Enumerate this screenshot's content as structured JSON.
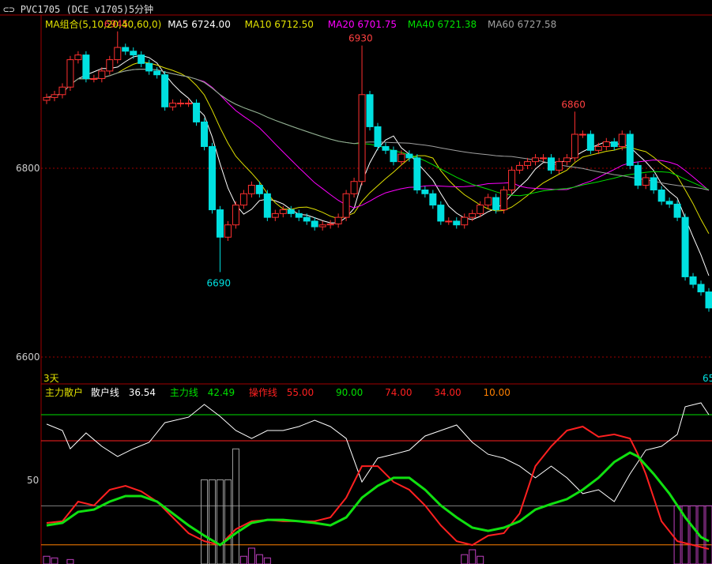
{
  "window": {
    "title": "PVC1705 (DCE v1705)5分钟",
    "icon": "link-icon"
  },
  "legend": {
    "group": "MA组合(5,10,20,40,60,0)",
    "items": [
      {
        "label": "MA5 6724.00",
        "color": "#ffffff"
      },
      {
        "label": "MA10 6712.50",
        "color": "#e0e000"
      },
      {
        "label": "MA20 6701.75",
        "color": "#ff00ff"
      },
      {
        "label": "MA40 6721.38",
        "color": "#00e000"
      },
      {
        "label": "MA60 6727.58",
        "color": "#a0a0a0"
      }
    ]
  },
  "price_axis": {
    "ticks": [
      "6800",
      "6600"
    ]
  },
  "bottom_label": "3天",
  "right_cut_label": "65",
  "indicator": {
    "name": "主力散户",
    "items": [
      {
        "label": "散户线",
        "value": "36.54",
        "color": "#ffffff"
      },
      {
        "label": "主力线",
        "value": "42.49",
        "color": "#00e000"
      },
      {
        "label": "操作线",
        "value": "55.00",
        "color": "#ff2020"
      }
    ],
    "levels": [
      {
        "value": "90.00",
        "color": "#00e000"
      },
      {
        "value": "74.00",
        "color": "#ff2020"
      },
      {
        "value": "34.00",
        "color": "#ff2020"
      },
      {
        "value": "10.00",
        "color": "#ff8000"
      }
    ],
    "axis_tick": "50"
  },
  "chart_data": [
    {
      "type": "candlestick",
      "title": "PVC1705 5分钟",
      "ylim": [
        6600,
        6950
      ],
      "close": [
        6875,
        6878,
        6886,
        6915,
        6920,
        6895,
        6895,
        6903,
        6915,
        6928,
        6924,
        6920,
        6911,
        6903,
        6899,
        6865,
        6869,
        6869,
        6869,
        6849,
        6823,
        6756,
        6727,
        6740,
        6761,
        6773,
        6782,
        6773,
        6748,
        6752,
        6756,
        6752,
        6748,
        6744,
        6738,
        6740,
        6741,
        6748,
        6773,
        6786,
        6878,
        6844,
        6823,
        6819,
        6807,
        6815,
        6811,
        6777,
        6773,
        6761,
        6744,
        6744,
        6740,
        6748,
        6752,
        6761,
        6769,
        6756,
        6777,
        6798,
        6803,
        6807,
        6811,
        6811,
        6798,
        6807,
        6811,
        6836,
        6836,
        6819,
        6823,
        6828,
        6823,
        6836,
        6803,
        6782,
        6790,
        6777,
        6765,
        6762,
        6748,
        6685,
        6677,
        6669,
        6652
      ],
      "annotations": [
        {
          "index": 9,
          "price": 6945,
          "label": "6945",
          "color": "#ff4040"
        },
        {
          "index": 40,
          "price": 6930,
          "label": "6930",
          "color": "#ff4040"
        },
        {
          "index": 22,
          "price": 6690,
          "label": "6690",
          "color": "#00e0e0"
        },
        {
          "index": 67,
          "price": 6860,
          "label": "6860",
          "color": "#ff4040"
        }
      ],
      "ma_periods": [
        5,
        10,
        20,
        40,
        60
      ]
    },
    {
      "type": "line",
      "title": "主力散户",
      "ylim": [
        -2,
        100
      ],
      "series": [
        {
          "name": "散户线",
          "color": "#ffffff",
          "points": [
            [
              0,
              84.2
            ],
            [
              2,
              80.3
            ],
            [
              3,
              69.1
            ],
            [
              5,
              78.8
            ],
            [
              7,
              70.6
            ],
            [
              9,
              64.3
            ],
            [
              11,
              69.1
            ],
            [
              13,
              73
            ],
            [
              15,
              85.1
            ],
            [
              18,
              88.5
            ],
            [
              20,
              96.3
            ],
            [
              22,
              89
            ],
            [
              24,
              80.3
            ],
            [
              26,
              75.4
            ],
            [
              28,
              80.3
            ],
            [
              30,
              80.3
            ],
            [
              32,
              82.7
            ],
            [
              34,
              86.6
            ],
            [
              36,
              82.7
            ],
            [
              38,
              75.4
            ],
            [
              40,
              48.7
            ],
            [
              42,
              63.3
            ],
            [
              44,
              65.7
            ],
            [
              46,
              68.2
            ],
            [
              48,
              76.9
            ],
            [
              50,
              80.3
            ],
            [
              52,
              83.7
            ],
            [
              54,
              73
            ],
            [
              56,
              65.7
            ],
            [
              58,
              63.3
            ],
            [
              60,
              58.4
            ],
            [
              62,
              51.2
            ],
            [
              64,
              58.4
            ],
            [
              66,
              51.2
            ],
            [
              68,
              41.5
            ],
            [
              70,
              43.9
            ],
            [
              72,
              36.6
            ],
            [
              74,
              53.6
            ],
            [
              76,
              68.2
            ],
            [
              78,
              70.6
            ],
            [
              80,
              77.9
            ],
            [
              81,
              94.9
            ],
            [
              83,
              97.3
            ],
            [
              84,
              90
            ]
          ]
        },
        {
          "name": "操作线",
          "color": "#ff2020",
          "points": [
            [
              0,
              23.5
            ],
            [
              2,
              24.5
            ],
            [
              4,
              36.6
            ],
            [
              6,
              34.2
            ],
            [
              8,
              43.9
            ],
            [
              10,
              46.3
            ],
            [
              12,
              42.9
            ],
            [
              14,
              36.6
            ],
            [
              16,
              26.9
            ],
            [
              18,
              17.2
            ],
            [
              20,
              12.3
            ],
            [
              22,
              9.9
            ],
            [
              24,
              19.6
            ],
            [
              26,
              24.5
            ],
            [
              28,
              25.4
            ],
            [
              30,
              24.5
            ],
            [
              32,
              24.5
            ],
            [
              34,
              24.5
            ],
            [
              36,
              26.9
            ],
            [
              38,
              39
            ],
            [
              40,
              58.4
            ],
            [
              42,
              58.4
            ],
            [
              44,
              48.7
            ],
            [
              46,
              43.9
            ],
            [
              48,
              34.2
            ],
            [
              50,
              22
            ],
            [
              52,
              12.3
            ],
            [
              54,
              9.9
            ],
            [
              56,
              15.7
            ],
            [
              58,
              17.2
            ],
            [
              60,
              29.3
            ],
            [
              62,
              58.4
            ],
            [
              64,
              70.6
            ],
            [
              66,
              80.3
            ],
            [
              68,
              82.7
            ],
            [
              70,
              76.4
            ],
            [
              72,
              77.9
            ],
            [
              74,
              75.4
            ],
            [
              75,
              65.7
            ],
            [
              76,
              53.6
            ],
            [
              78,
              24.5
            ],
            [
              80,
              12.3
            ],
            [
              82,
              9.9
            ],
            [
              84,
              7.5
            ]
          ]
        },
        {
          "name": "主力线",
          "color": "#10e010",
          "points": [
            [
              0,
              22
            ],
            [
              2,
              23.5
            ],
            [
              4,
              30.3
            ],
            [
              6,
              31.7
            ],
            [
              8,
              36.6
            ],
            [
              10,
              40
            ],
            [
              12,
              40
            ],
            [
              14,
              36.6
            ],
            [
              16,
              29.3
            ],
            [
              18,
              22
            ],
            [
              20,
              15.7
            ],
            [
              22,
              9.9
            ],
            [
              24,
              17.2
            ],
            [
              26,
              23.5
            ],
            [
              28,
              25.4
            ],
            [
              30,
              25.4
            ],
            [
              32,
              24.5
            ],
            [
              34,
              23.5
            ],
            [
              36,
              22
            ],
            [
              38,
              26.9
            ],
            [
              40,
              39
            ],
            [
              42,
              46.3
            ],
            [
              44,
              51.2
            ],
            [
              46,
              51.2
            ],
            [
              48,
              43.9
            ],
            [
              50,
              34.2
            ],
            [
              52,
              26.9
            ],
            [
              54,
              20.6
            ],
            [
              56,
              18.6
            ],
            [
              58,
              20.6
            ],
            [
              60,
              24.5
            ],
            [
              62,
              31.7
            ],
            [
              64,
              35.1
            ],
            [
              66,
              38.1
            ],
            [
              68,
              43.9
            ],
            [
              70,
              51.2
            ],
            [
              72,
              60.9
            ],
            [
              74,
              66.7
            ],
            [
              75,
              64.3
            ],
            [
              77,
              53.6
            ],
            [
              79,
              41.5
            ],
            [
              81,
              26.9
            ],
            [
              83,
              14.8
            ],
            [
              84,
              12.3
            ]
          ]
        }
      ],
      "bars": [
        [
          0,
          3
        ],
        [
          1,
          2
        ],
        [
          3,
          1
        ],
        [
          20,
          50
        ],
        [
          21,
          50
        ],
        [
          22,
          50
        ],
        [
          23,
          50
        ],
        [
          24,
          69
        ],
        [
          25,
          3
        ],
        [
          26,
          8
        ],
        [
          27,
          4
        ],
        [
          28,
          2
        ],
        [
          53,
          4
        ],
        [
          54,
          7
        ],
        [
          55,
          3
        ],
        [
          80,
          34
        ],
        [
          81,
          34
        ],
        [
          82,
          34
        ],
        [
          83,
          34
        ],
        [
          84,
          34
        ]
      ],
      "hlines": [
        90,
        74,
        34,
        10
      ]
    }
  ]
}
